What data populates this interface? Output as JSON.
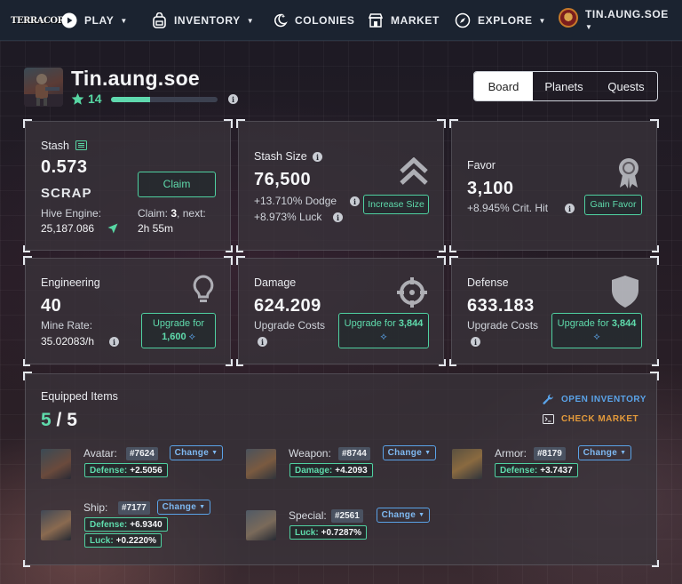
{
  "nav": {
    "logo": "TERRACORE",
    "play": "PLAY",
    "inventory": "INVENTORY",
    "colonies": "COLONIES",
    "market": "MARKET",
    "explore": "EXPLORE",
    "username": "TIN.AUNG.SOE"
  },
  "profile": {
    "name": "Tin.aung.soe",
    "level": "14",
    "xp_progress": 0.37
  },
  "tabs": [
    "Board",
    "Planets",
    "Quests"
  ],
  "stash": {
    "label": "Stash",
    "value": "0.573",
    "unit": "SCRAP",
    "hive_label": "Hive Engine:",
    "hive_value": "25,187.086",
    "claim_button": "Claim",
    "claim_label": "Claim:",
    "claim_count": "3",
    "next_label": ", next:",
    "next_time": "2h 55m"
  },
  "stash_size": {
    "label": "Stash Size",
    "value": "76,500",
    "dodge": "+13.710% Dodge",
    "luck": "+8.973% Luck",
    "button": "Increase Size"
  },
  "favor": {
    "label": "Favor",
    "value": "3,100",
    "crit": "+8.945% Crit. Hit",
    "button": "Gain Favor"
  },
  "engineering": {
    "label": "Engineering",
    "value": "40",
    "rate_label": "Mine Rate:",
    "rate_value": "35.02083/h",
    "button_line1": "Upgrade for",
    "button_cost": "1,600"
  },
  "damage": {
    "label": "Damage",
    "value": "624.209",
    "costs_label": "Upgrade Costs",
    "button_line1": "Upgrade for",
    "button_cost": "3,844"
  },
  "defense": {
    "label": "Defense",
    "value": "633.183",
    "costs_label": "Upgrade Costs",
    "button_line1": "Upgrade for",
    "button_cost": "3,844"
  },
  "equipped": {
    "title": "Equipped Items",
    "count": "5",
    "total": "5",
    "open_inventory": "OPEN INVENTORY",
    "check_market": "CHECK MARKET",
    "change_label": "Change",
    "items": [
      {
        "name": "Avatar:",
        "id": "#7624",
        "stats": [
          {
            "k": "Defense:",
            "v": "+2.5056"
          }
        ]
      },
      {
        "name": "Weapon:",
        "id": "#8744",
        "stats": [
          {
            "k": "Damage:",
            "v": "+4.2093"
          }
        ]
      },
      {
        "name": "Armor:",
        "id": "#8179",
        "stats": [
          {
            "k": "Defense:",
            "v": "+3.7437"
          }
        ]
      },
      {
        "name": "Ship:",
        "id": "#7177",
        "stats": [
          {
            "k": "Defense:",
            "v": "+6.9340"
          },
          {
            "k": "Luck:",
            "v": "+0.2220%"
          }
        ]
      },
      {
        "name": "Special:",
        "id": "#2561",
        "stats": [
          {
            "k": "Luck:",
            "v": "+0.7287%"
          }
        ]
      }
    ]
  },
  "colors": {
    "accent_green": "#5fdbac",
    "link_blue": "#5aa3e8",
    "market_orange": "#e39a3b",
    "nav_bg": "#1b2330"
  }
}
